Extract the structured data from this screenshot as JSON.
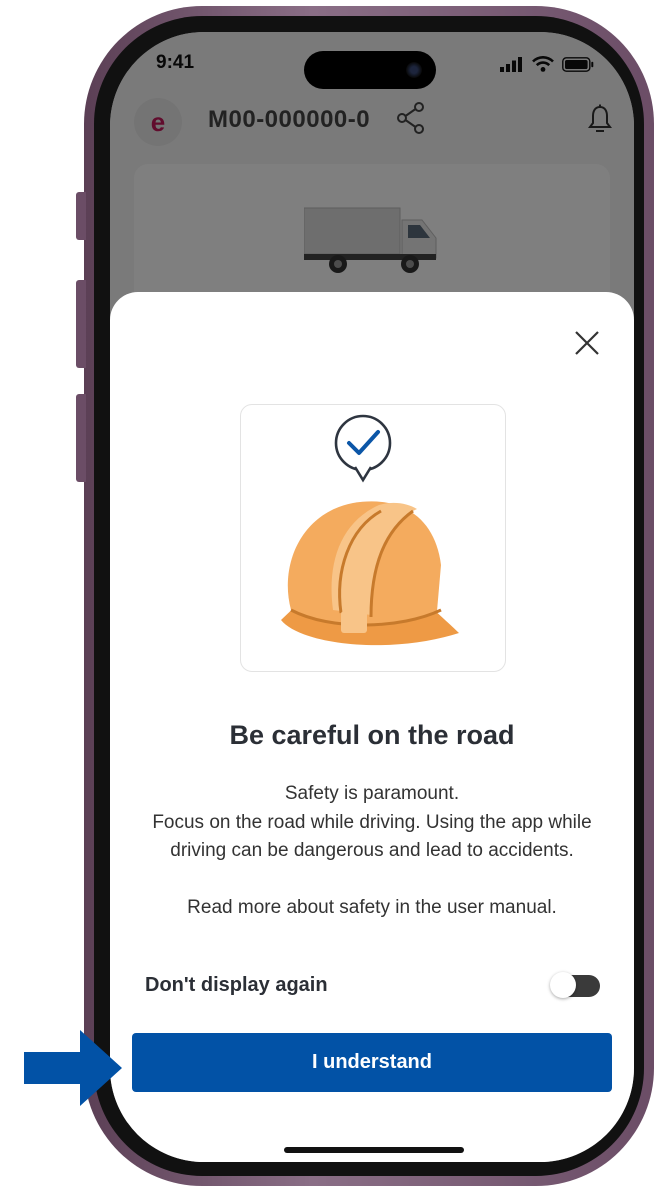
{
  "status_bar": {
    "time": "9:41",
    "icons": [
      "signal-icon",
      "wifi-icon",
      "battery-icon"
    ]
  },
  "header": {
    "logo_letter": "e",
    "vehicle_id": "M00-000000-0",
    "icons": [
      "share-icon",
      "bell-icon"
    ]
  },
  "modal": {
    "close_icon": "close-icon",
    "illustration": "safety-helmet-checkmark-icon",
    "title": "Be careful on the road",
    "body_lines": [
      "Safety is paramount.",
      "Focus on the road while driving. Using the app while driving can be dangerous and lead to accidents."
    ],
    "manual_note": "Read more about safety in the user manual.",
    "toggle": {
      "label": "Don't display again",
      "checked": false
    },
    "primary_button": "I understand"
  },
  "colors": {
    "primary": "#0252a6",
    "frame": "#6b4d66",
    "helmet": "#f1a556"
  }
}
